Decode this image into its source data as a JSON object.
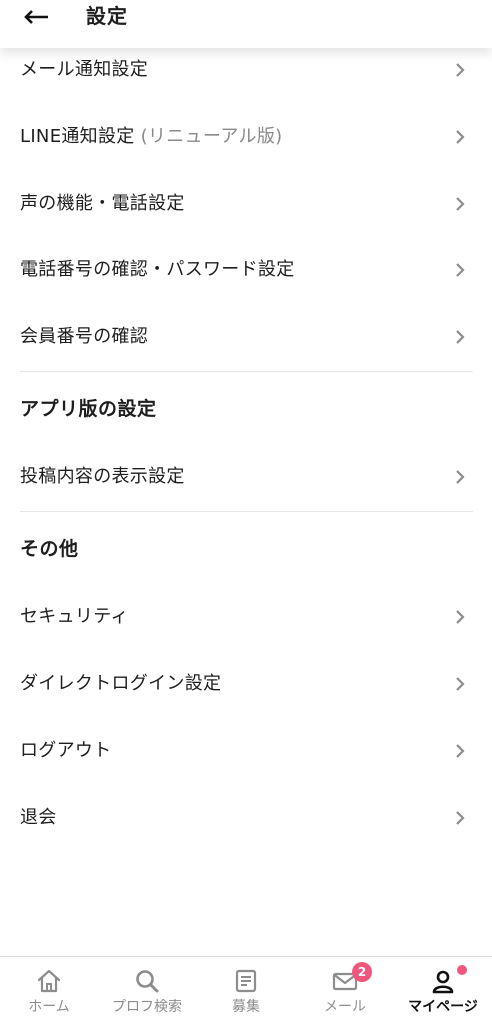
{
  "header": {
    "back_icon": "arrow-left-icon",
    "title": "設定"
  },
  "account_settings": {
    "items": [
      {
        "label": "メール通知設定"
      },
      {
        "label": "LINE通知設定",
        "sub": " (リニューアル版)"
      },
      {
        "label": "声の機能・電話設定"
      },
      {
        "label": "電話番号の確認・パスワード設定"
      },
      {
        "label": "会員番号の確認"
      }
    ]
  },
  "app_settings": {
    "title": "アプリ版の設定",
    "items": [
      {
        "label": "投稿内容の表示設定"
      }
    ]
  },
  "other": {
    "title": "その他",
    "items": [
      {
        "label": "セキュリティ"
      },
      {
        "label": "ダイレクトログイン設定"
      },
      {
        "label": "ログアウト"
      },
      {
        "label": "退会"
      }
    ]
  },
  "bottom_nav": {
    "items": [
      {
        "label": "ホーム",
        "icon": "home-icon"
      },
      {
        "label": "プロフ検索",
        "icon": "search-icon"
      },
      {
        "label": "募集",
        "icon": "document-icon"
      },
      {
        "label": "メール",
        "icon": "mail-icon",
        "badge": "2"
      },
      {
        "label": "マイページ",
        "icon": "person-icon",
        "active": true,
        "dot": true
      }
    ]
  },
  "colors": {
    "accent": "#f0577e",
    "text": "#1e1e1e",
    "muted": "#8d8d8d",
    "chevron": "#8c8c8c"
  }
}
